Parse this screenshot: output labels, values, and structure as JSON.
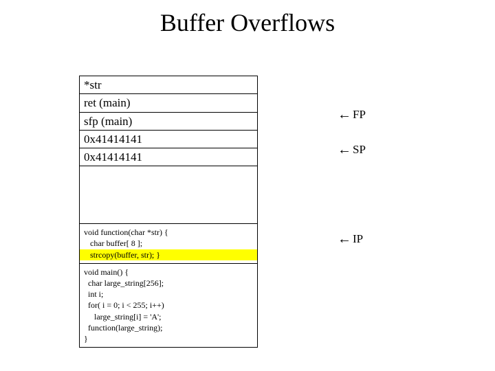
{
  "title": "Buffer Overflows",
  "stack": {
    "str": "*str",
    "ret": "ret (main)",
    "sfp": "sfp (main)",
    "buf1": "0x41414141",
    "buf2": "0x41414141"
  },
  "pointers": {
    "fp": "FP",
    "sp": "SP",
    "ip": "IP"
  },
  "arrow": "←",
  "code_fn": {
    "l1": "void function(char *str) {",
    "l2": "   char buffer[ 8 ];",
    "l3": "   strcopy(buffer, str); }"
  },
  "code_main": {
    "l1": "void main() {",
    "l2": "  char large_string[256];",
    "l3": "  int i;",
    "l4": "  for( i = 0; i < 255; i++)",
    "l5": "     large_string[i] = 'A';",
    "l6": "  function(large_string);",
    "l7": "}"
  }
}
